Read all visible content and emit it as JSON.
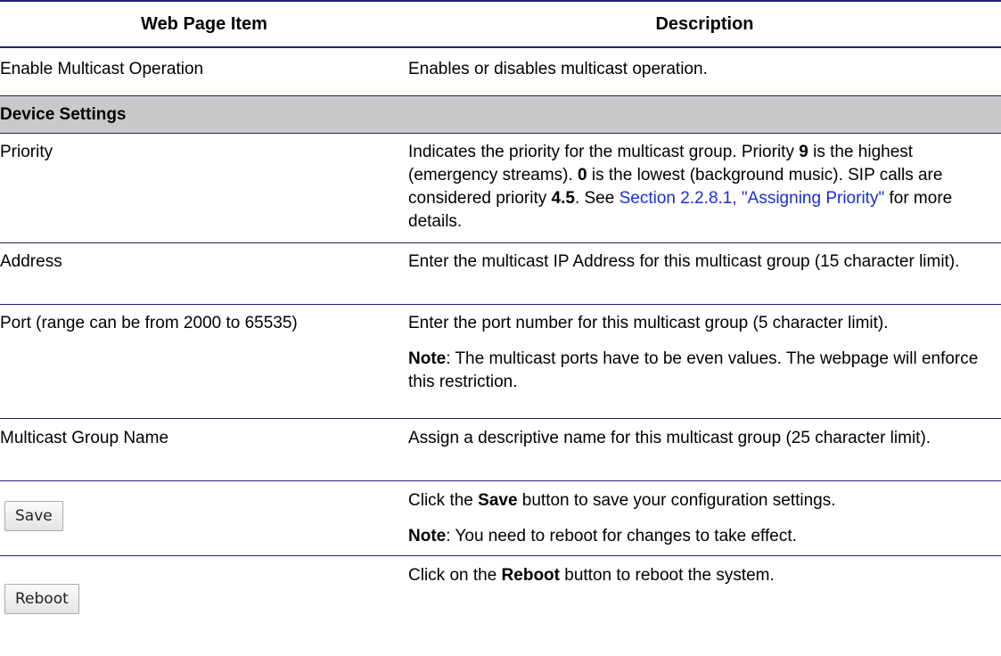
{
  "table": {
    "headers": {
      "item": "Web Page Item",
      "description": "Description"
    },
    "rows": {
      "enable": {
        "item": "Enable Multicast Operation",
        "desc": "Enables or disables multicast operation."
      },
      "section": {
        "label": "Device Settings"
      },
      "priority": {
        "item": "Priority",
        "d1": "Indicates the priority for the multicast group. Priority ",
        "d1b": "9",
        "d2": " is the highest (emergency streams). ",
        "d2b": "0",
        "d3": " is the lowest (background music). SIP calls are considered priority ",
        "d3b": "4.5",
        "d4": ". See ",
        "link": "Section 2.2.8.1, \"Assigning Priority\"",
        "d5": " for more details."
      },
      "address": {
        "item": "Address",
        "desc": "Enter the multicast IP Address for this multicast group (15 character limit)."
      },
      "port": {
        "item": "Port (range can be from 2000 to 65535)",
        "desc": "Enter the port number for this multicast group (5 character limit).",
        "note_label": "Note",
        "note_text": ": The multicast ports have to be even values. The webpage will enforce this restriction."
      },
      "group_name": {
        "item": "Multicast Group Name",
        "desc": "Assign a descriptive name for this multicast group (25 character limit)."
      },
      "save": {
        "button_label": "Save",
        "d1": "Click the ",
        "d1b": "Save",
        "d2": " button to save your configuration settings.",
        "note_label": "Note",
        "note_text": ": You need to reboot for changes to take effect."
      },
      "reboot": {
        "button_label": "Reboot",
        "d1": "Click on the ",
        "d1b": "Reboot",
        "d2": " button to reboot the system."
      }
    }
  }
}
